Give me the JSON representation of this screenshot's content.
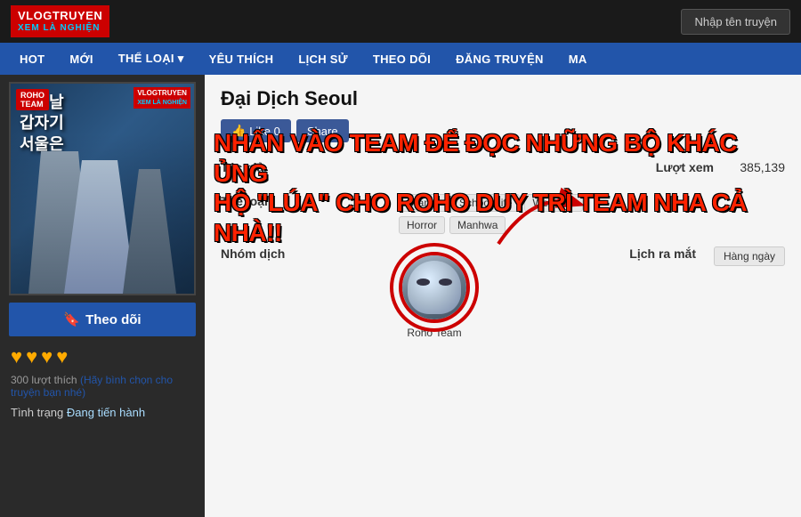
{
  "header": {
    "logo_line1": "VLOGTRUYEN",
    "logo_line2": "XEM LÀ NGHIỆN",
    "search_placeholder": "Nhập tên truyện"
  },
  "nav": {
    "items": [
      {
        "label": "HOT",
        "id": "hot"
      },
      {
        "label": "MỚI",
        "id": "moi"
      },
      {
        "label": "THỂ LOẠI ▾",
        "id": "the-loai"
      },
      {
        "label": "YÊU THÍCH",
        "id": "yeu-thich"
      },
      {
        "label": "LỊCH SỬ",
        "id": "lich-su"
      },
      {
        "label": "THEO DÕI",
        "id": "theo-doi"
      },
      {
        "label": "ĐĂNG TRUYỆN",
        "id": "dang-truyen"
      },
      {
        "label": "MA",
        "id": "ma"
      }
    ]
  },
  "sidebar": {
    "follow_label": "Theo dõi",
    "stars": [
      "★",
      "★",
      "★",
      "★"
    ],
    "votes": "300 lượt thích",
    "vote_cta": " (Hãy bình chọn cho truyện bạn nhé)",
    "status_label": "Tình trạng",
    "status_value": "Đang tiến hành"
  },
  "content": {
    "title": "Đại Dịch Seoul",
    "like_label": "Like 0",
    "share_label": "Share",
    "overlay_line1": "NHẤN VÀO TEAM ĐỂ ĐỌC NHỮNG BỘ KHÁC ỦNG",
    "overlay_line2": "HỘ \"LÚA\" CHO ROHO DUY TRÌ TEAM NHA CẢ NHÀ!!",
    "tac_gia_label": "Tác giả",
    "tac_gia_value": "",
    "luot_xem_label": "Lượt xem",
    "luot_xem_value": "385,139",
    "the_loai_label": "Thể loại",
    "tags": [
      "Drama",
      "School Life",
      "Webtoon",
      "Horror",
      "Manhwa"
    ],
    "nhom_dich_label": "Nhóm dịch",
    "lich_ra_mat_label": "Lịch ra mắt",
    "lich_ra_mat_value": "Hàng ngày",
    "team_name": "Roho Team"
  }
}
